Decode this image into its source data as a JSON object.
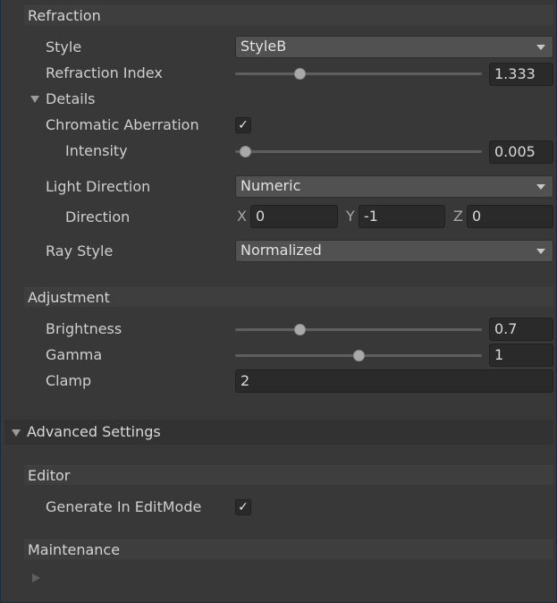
{
  "refraction": {
    "header": "Refraction",
    "style_label": "Style",
    "style_value": "StyleB",
    "refraction_index_label": "Refraction Index",
    "refraction_index_value": "1.333",
    "refraction_index_level": 0.25,
    "details_label": "Details",
    "chromatic_label": "Chromatic Aberration",
    "chromatic_checked": true,
    "check_glyph": "✓",
    "intensity_label": "Intensity",
    "intensity_value": "0.005",
    "intensity_level": 0.02,
    "light_direction_label": "Light Direction",
    "light_direction_value": "Numeric",
    "direction_label": "Direction",
    "direction": {
      "x_label": "X",
      "x_value": "0",
      "y_label": "Y",
      "y_value": "-1",
      "z_label": "Z",
      "z_value": "0"
    },
    "ray_style_label": "Ray Style",
    "ray_style_value": "Normalized"
  },
  "adjustment": {
    "header": "Adjustment",
    "brightness_label": "Brightness",
    "brightness_value": "0.7",
    "brightness_level": 0.25,
    "gamma_label": "Gamma",
    "gamma_value": "1",
    "gamma_level": 0.5,
    "clamp_label": "Clamp",
    "clamp_value": "2"
  },
  "advanced": {
    "header": "Advanced Settings"
  },
  "editor": {
    "header": "Editor",
    "generate_label": "Generate In EditMode",
    "generate_checked": true
  },
  "maintenance": {
    "header": "Maintenance"
  },
  "colors": {
    "background": "#383838",
    "section_header": "#3e3e3e",
    "foldout_header": "#323232",
    "field": "#2a2a2a",
    "dropdown": "#515151",
    "text": "#d2d2d2"
  }
}
